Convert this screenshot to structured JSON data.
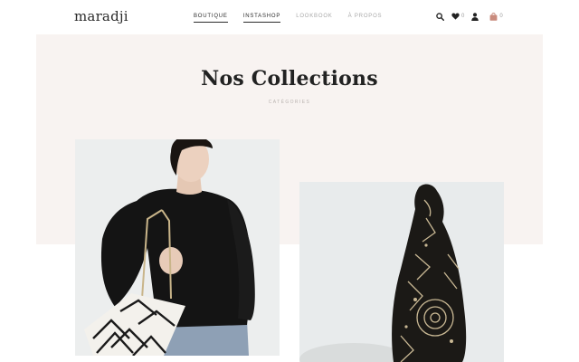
{
  "brand": {
    "logo_text": "maradji"
  },
  "nav": {
    "items": [
      {
        "label": "BOUTIQUE",
        "active": true
      },
      {
        "label": "INSTASHOP",
        "active": true
      },
      {
        "label": "LOOKBOOK",
        "active": false
      },
      {
        "label": "À PROPOS",
        "active": false
      }
    ]
  },
  "tools": {
    "search_icon": "search-icon",
    "wishlist_icon": "heart-icon",
    "wishlist_count": "0",
    "account_icon": "user-icon",
    "cart_icon": "shopping-bag-icon",
    "cart_count": "0"
  },
  "hero": {
    "title": "Nos Collections",
    "subtitle": "CATÉGORIES"
  },
  "colors": {
    "hero_background": "#f8f3f1",
    "cart_accent": "#c98b7d",
    "nav_inactive": "#a8a8a8",
    "text_dark": "#222222"
  }
}
